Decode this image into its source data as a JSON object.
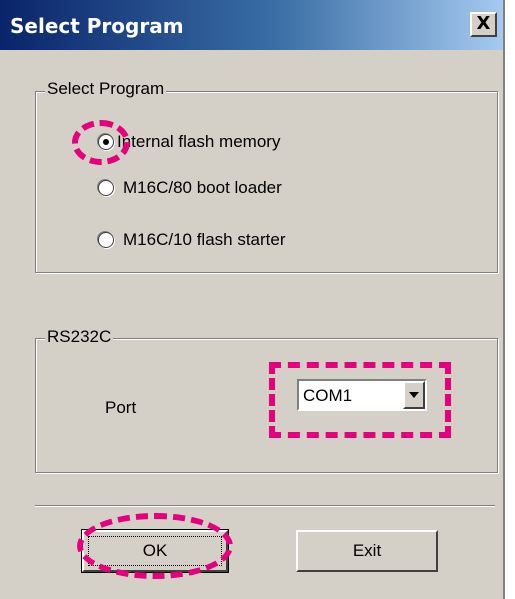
{
  "window": {
    "title": "Select Program",
    "close_label": "X"
  },
  "program_group": {
    "legend": "Select Program",
    "options": [
      {
        "label": "Internal flash memory",
        "selected": true
      },
      {
        "label": "M16C/80 boot loader",
        "selected": false
      },
      {
        "label": "M16C/10 flash starter",
        "selected": false
      }
    ]
  },
  "rs232c_group": {
    "legend": "RS232C",
    "port_label": "Port",
    "port_value": "COM1"
  },
  "buttons": {
    "ok": "OK",
    "exit": "Exit"
  },
  "colors": {
    "highlight": "#e6007e",
    "titlebar": "#0a246a",
    "face": "#d4d0c8"
  }
}
